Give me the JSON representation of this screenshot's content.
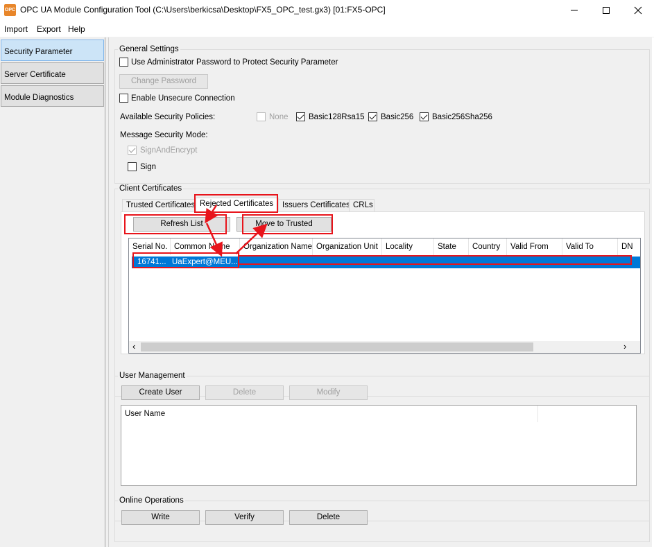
{
  "window": {
    "icon_text": "OPC",
    "title": "OPC UA Module Configuration Tool (C:\\Users\\berkicsa\\Desktop\\FX5_OPC_test.gx3) [01:FX5-OPC]"
  },
  "menu": {
    "items": [
      {
        "label": "Import",
        "accel": "I"
      },
      {
        "label": "Export",
        "accel": "E"
      },
      {
        "label": "Help",
        "accel": "H"
      }
    ]
  },
  "nav": {
    "items": [
      {
        "label": "Security Parameter",
        "active": true
      },
      {
        "label": "Server Certificate",
        "active": false
      },
      {
        "label": "Module Diagnostics",
        "active": false
      }
    ]
  },
  "general_settings": {
    "title": "General Settings",
    "use_admin_password_label": "Use Administrator Password to Protect Security Parameter",
    "use_admin_password_checked": false,
    "change_password_label": "Change Password",
    "enable_unsecure_label": "Enable Unsecure Connection",
    "enable_unsecure_checked": false,
    "policies_label": "Available Security Policies:",
    "policies": [
      {
        "label": "None",
        "checked": false,
        "enabled": false
      },
      {
        "label": "Basic128Rsa15",
        "checked": true,
        "enabled": true
      },
      {
        "label": "Basic256",
        "checked": true,
        "enabled": true
      },
      {
        "label": "Basic256Sha256",
        "checked": true,
        "enabled": true
      }
    ],
    "message_mode_label": "Message Security Mode:",
    "modes": [
      {
        "label": "SignAndEncrypt",
        "checked": true,
        "enabled": false
      },
      {
        "label": "Sign",
        "checked": false,
        "enabled": true
      }
    ]
  },
  "client_certificates": {
    "title": "Client Certificates",
    "tabs": [
      {
        "label": "Trusted Certificates",
        "active": false
      },
      {
        "label": "Rejected Certificates",
        "active": true
      },
      {
        "label": "Issuers Certificates",
        "active": false
      },
      {
        "label": "CRLs",
        "active": false
      }
    ],
    "refresh_label": "Refresh List",
    "move_label": "Move to Trusted",
    "columns": [
      "Serial No.",
      "Common Name",
      "Organization Name",
      "Organization Unit",
      "Locality",
      "State",
      "Country",
      "Valid From",
      "Valid To",
      "DN"
    ],
    "rows": [
      {
        "serial": "16741...",
        "common_name": "UaExpert@MEU..."
      }
    ],
    "scroll_left_arrow": "‹",
    "scroll_right_arrow": "›"
  },
  "user_management": {
    "title": "User Management",
    "create_label": "Create User",
    "delete_label": "Delete",
    "modify_label": "Modify",
    "column_user_name": "User Name"
  },
  "online_operations": {
    "title": "Online Operations",
    "write_label": "Write",
    "verify_label": "Verify",
    "delete_label": "Delete"
  },
  "colors": {
    "selection": "#0078d7",
    "annotation_red": "#e8141b",
    "nav_active": "#cce4f7"
  }
}
